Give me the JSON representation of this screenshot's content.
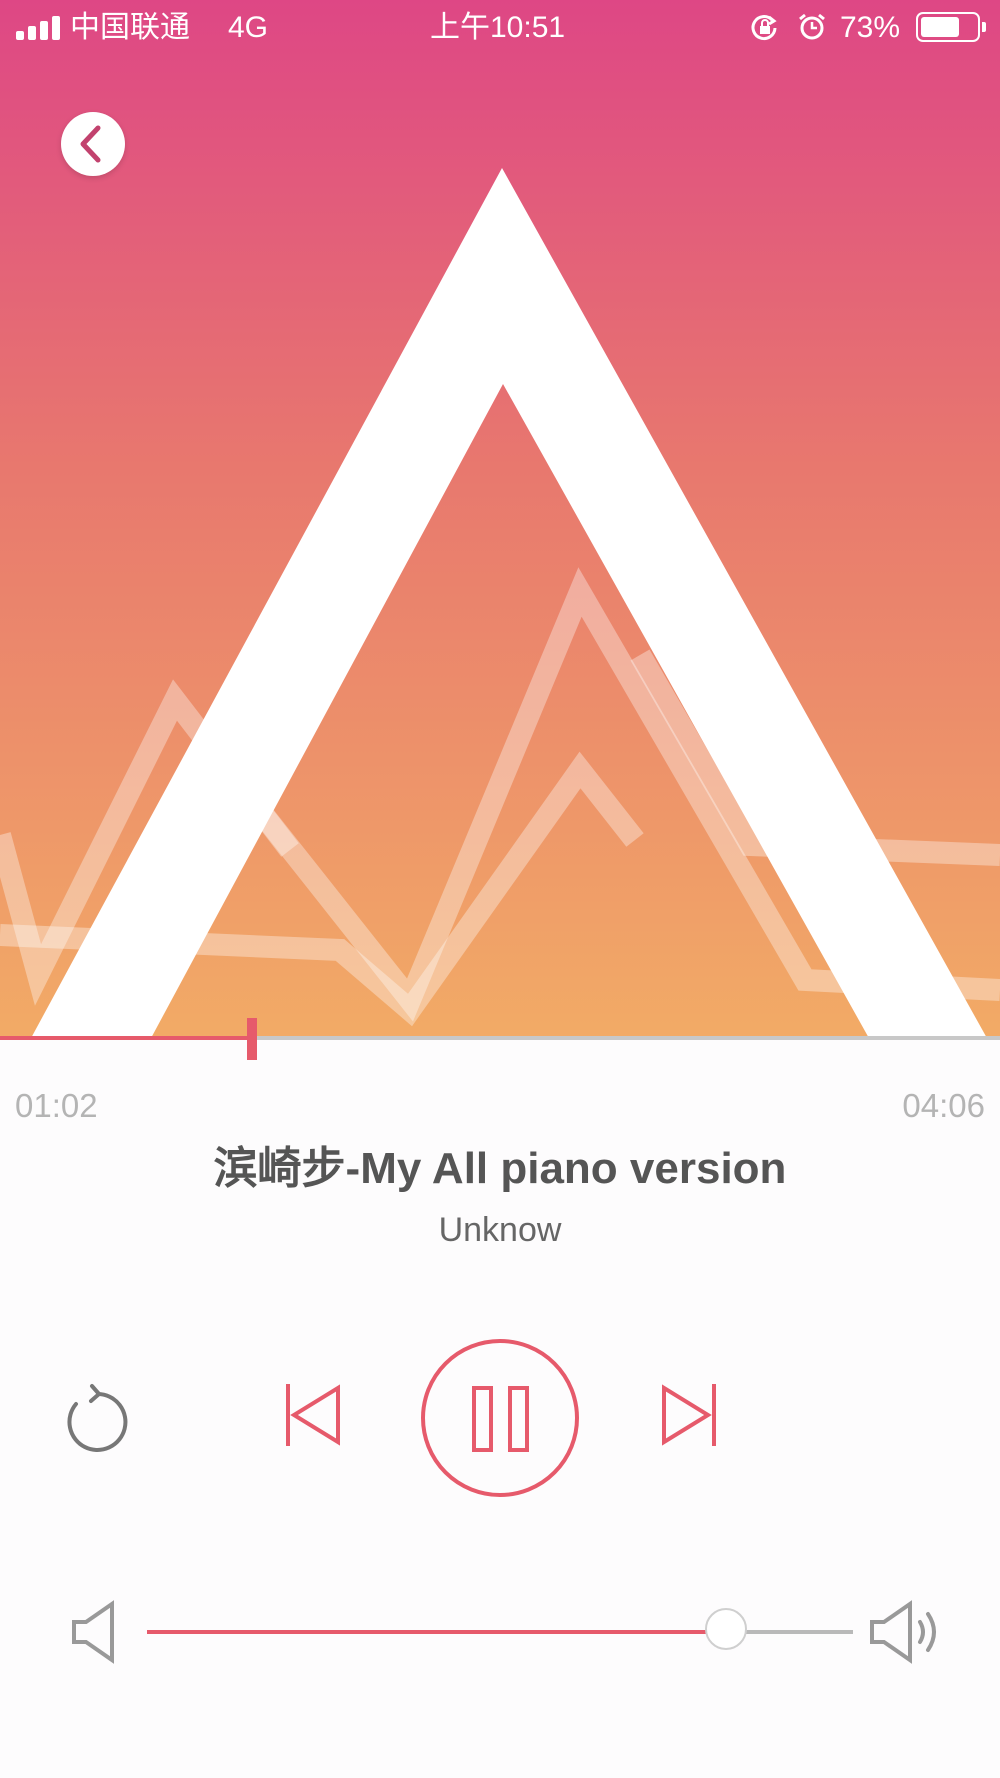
{
  "status_bar": {
    "carrier": "中国联通",
    "network": "4G",
    "time": "上午10:51",
    "battery_percent": "73%",
    "battery_level": 0.73
  },
  "player": {
    "current_time": "01:02",
    "total_time": "04:06",
    "progress": 0.252,
    "title": "滨崎步-My All piano version",
    "artist": "Unknow",
    "volume": 0.82,
    "state": "playing"
  },
  "icons": {
    "back": "chevron-left-icon",
    "repeat": "repeat-icon",
    "previous": "skip-previous-icon",
    "pause": "pause-icon",
    "next": "skip-next-icon",
    "volume_low": "volume-low-icon",
    "volume_high": "volume-high-icon"
  },
  "colors": {
    "accent": "#e65a6b",
    "gradient_top": "#de4785",
    "gradient_bottom": "#f2ab66",
    "text_primary": "#555555",
    "text_muted": "#b4b4b4"
  }
}
